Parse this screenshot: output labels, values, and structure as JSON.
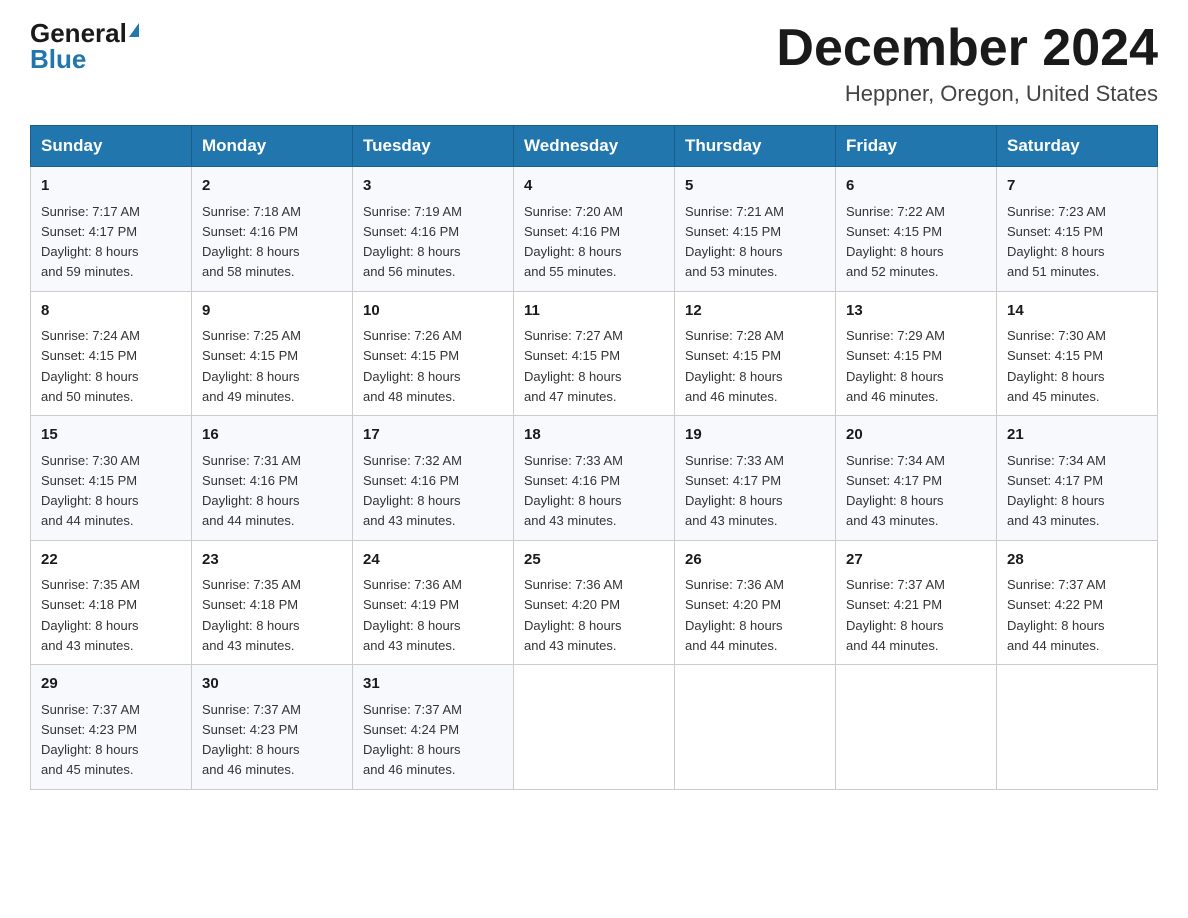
{
  "header": {
    "logo_general": "General",
    "logo_blue": "Blue",
    "title": "December 2024",
    "location": "Heppner, Oregon, United States"
  },
  "days_of_week": [
    "Sunday",
    "Monday",
    "Tuesday",
    "Wednesday",
    "Thursday",
    "Friday",
    "Saturday"
  ],
  "weeks": [
    [
      {
        "day": "1",
        "sunrise": "7:17 AM",
        "sunset": "4:17 PM",
        "daylight": "8 hours and 59 minutes."
      },
      {
        "day": "2",
        "sunrise": "7:18 AM",
        "sunset": "4:16 PM",
        "daylight": "8 hours and 58 minutes."
      },
      {
        "day": "3",
        "sunrise": "7:19 AM",
        "sunset": "4:16 PM",
        "daylight": "8 hours and 56 minutes."
      },
      {
        "day": "4",
        "sunrise": "7:20 AM",
        "sunset": "4:16 PM",
        "daylight": "8 hours and 55 minutes."
      },
      {
        "day": "5",
        "sunrise": "7:21 AM",
        "sunset": "4:15 PM",
        "daylight": "8 hours and 53 minutes."
      },
      {
        "day": "6",
        "sunrise": "7:22 AM",
        "sunset": "4:15 PM",
        "daylight": "8 hours and 52 minutes."
      },
      {
        "day": "7",
        "sunrise": "7:23 AM",
        "sunset": "4:15 PM",
        "daylight": "8 hours and 51 minutes."
      }
    ],
    [
      {
        "day": "8",
        "sunrise": "7:24 AM",
        "sunset": "4:15 PM",
        "daylight": "8 hours and 50 minutes."
      },
      {
        "day": "9",
        "sunrise": "7:25 AM",
        "sunset": "4:15 PM",
        "daylight": "8 hours and 49 minutes."
      },
      {
        "day": "10",
        "sunrise": "7:26 AM",
        "sunset": "4:15 PM",
        "daylight": "8 hours and 48 minutes."
      },
      {
        "day": "11",
        "sunrise": "7:27 AM",
        "sunset": "4:15 PM",
        "daylight": "8 hours and 47 minutes."
      },
      {
        "day": "12",
        "sunrise": "7:28 AM",
        "sunset": "4:15 PM",
        "daylight": "8 hours and 46 minutes."
      },
      {
        "day": "13",
        "sunrise": "7:29 AM",
        "sunset": "4:15 PM",
        "daylight": "8 hours and 46 minutes."
      },
      {
        "day": "14",
        "sunrise": "7:30 AM",
        "sunset": "4:15 PM",
        "daylight": "8 hours and 45 minutes."
      }
    ],
    [
      {
        "day": "15",
        "sunrise": "7:30 AM",
        "sunset": "4:15 PM",
        "daylight": "8 hours and 44 minutes."
      },
      {
        "day": "16",
        "sunrise": "7:31 AM",
        "sunset": "4:16 PM",
        "daylight": "8 hours and 44 minutes."
      },
      {
        "day": "17",
        "sunrise": "7:32 AM",
        "sunset": "4:16 PM",
        "daylight": "8 hours and 43 minutes."
      },
      {
        "day": "18",
        "sunrise": "7:33 AM",
        "sunset": "4:16 PM",
        "daylight": "8 hours and 43 minutes."
      },
      {
        "day": "19",
        "sunrise": "7:33 AM",
        "sunset": "4:17 PM",
        "daylight": "8 hours and 43 minutes."
      },
      {
        "day": "20",
        "sunrise": "7:34 AM",
        "sunset": "4:17 PM",
        "daylight": "8 hours and 43 minutes."
      },
      {
        "day": "21",
        "sunrise": "7:34 AM",
        "sunset": "4:17 PM",
        "daylight": "8 hours and 43 minutes."
      }
    ],
    [
      {
        "day": "22",
        "sunrise": "7:35 AM",
        "sunset": "4:18 PM",
        "daylight": "8 hours and 43 minutes."
      },
      {
        "day": "23",
        "sunrise": "7:35 AM",
        "sunset": "4:18 PM",
        "daylight": "8 hours and 43 minutes."
      },
      {
        "day": "24",
        "sunrise": "7:36 AM",
        "sunset": "4:19 PM",
        "daylight": "8 hours and 43 minutes."
      },
      {
        "day": "25",
        "sunrise": "7:36 AM",
        "sunset": "4:20 PM",
        "daylight": "8 hours and 43 minutes."
      },
      {
        "day": "26",
        "sunrise": "7:36 AM",
        "sunset": "4:20 PM",
        "daylight": "8 hours and 44 minutes."
      },
      {
        "day": "27",
        "sunrise": "7:37 AM",
        "sunset": "4:21 PM",
        "daylight": "8 hours and 44 minutes."
      },
      {
        "day": "28",
        "sunrise": "7:37 AM",
        "sunset": "4:22 PM",
        "daylight": "8 hours and 44 minutes."
      }
    ],
    [
      {
        "day": "29",
        "sunrise": "7:37 AM",
        "sunset": "4:23 PM",
        "daylight": "8 hours and 45 minutes."
      },
      {
        "day": "30",
        "sunrise": "7:37 AM",
        "sunset": "4:23 PM",
        "daylight": "8 hours and 46 minutes."
      },
      {
        "day": "31",
        "sunrise": "7:37 AM",
        "sunset": "4:24 PM",
        "daylight": "8 hours and 46 minutes."
      },
      null,
      null,
      null,
      null
    ]
  ],
  "labels": {
    "sunrise": "Sunrise:",
    "sunset": "Sunset:",
    "daylight": "Daylight:"
  }
}
